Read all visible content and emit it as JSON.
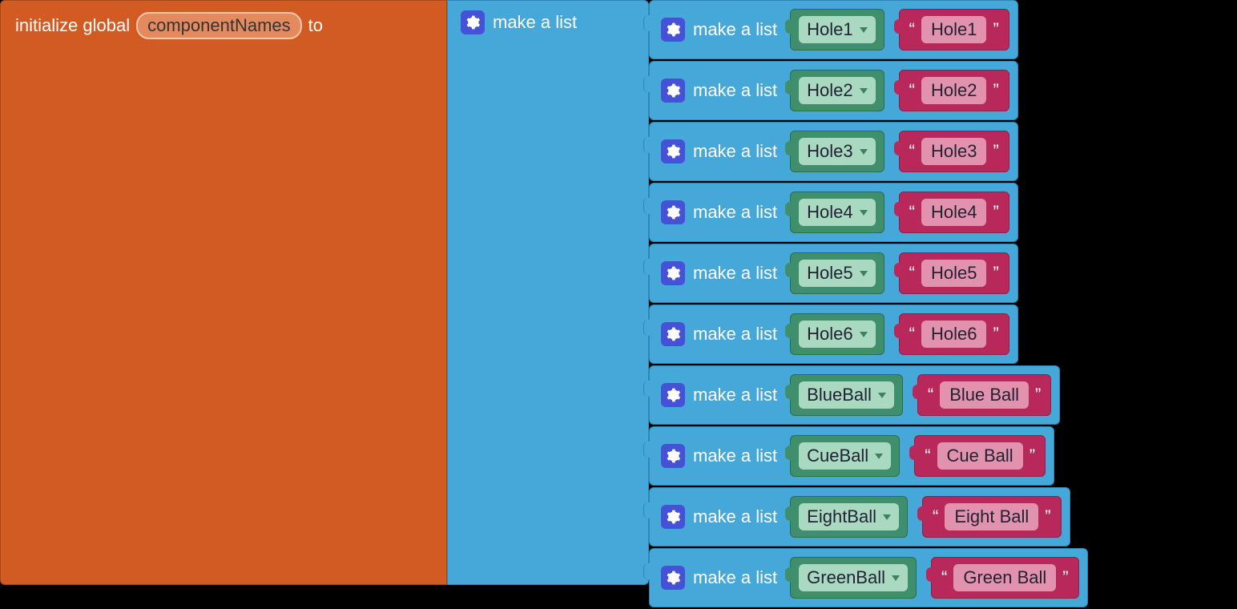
{
  "init": {
    "prefix": "initialize global",
    "varName": "componentNames",
    "suffix": "to"
  },
  "outerList": {
    "label": "make a list"
  },
  "rows": [
    {
      "label": "make a list",
      "component": "Hole1",
      "text": "Hole1"
    },
    {
      "label": "make a list",
      "component": "Hole2",
      "text": "Hole2"
    },
    {
      "label": "make a list",
      "component": "Hole3",
      "text": "Hole3"
    },
    {
      "label": "make a list",
      "component": "Hole4",
      "text": "Hole4"
    },
    {
      "label": "make a list",
      "component": "Hole5",
      "text": "Hole5"
    },
    {
      "label": "make a list",
      "component": "Hole6",
      "text": "Hole6"
    },
    {
      "label": "make a list",
      "component": "BlueBall",
      "text": "Blue Ball"
    },
    {
      "label": "make a list",
      "component": "CueBall",
      "text": "Cue Ball"
    },
    {
      "label": "make a list",
      "component": "EightBall",
      "text": "Eight Ball"
    },
    {
      "label": "make a list",
      "component": "GreenBall",
      "text": "Green Ball"
    }
  ],
  "quote": {
    "open": "“",
    "close": "”"
  }
}
